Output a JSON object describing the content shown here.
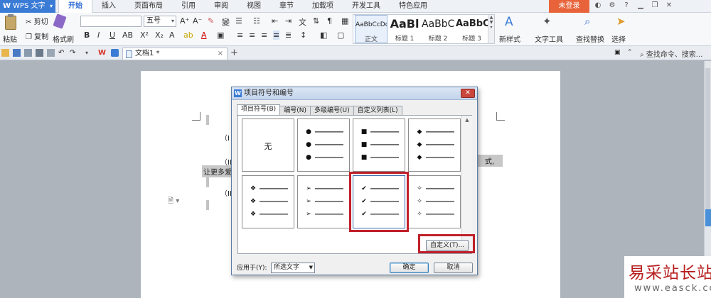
{
  "app": {
    "logo": "W",
    "name": "WPS 文字",
    "menu_arrow": "▾"
  },
  "menu_tabs": [
    "开始",
    "插入",
    "页面布局",
    "引用",
    "审阅",
    "视图",
    "章节",
    "加载项",
    "开发工具",
    "特色应用"
  ],
  "login_label": "未登录",
  "ribbon": {
    "paste": "粘贴",
    "cut": "剪切",
    "copy": "复制",
    "format_painter": "格式刷",
    "font_name": "",
    "font_size": "五号",
    "styles": [
      {
        "preview": "AaBbCcDd",
        "caption": "正文"
      },
      {
        "preview": "AaBl",
        "caption": "标题 1"
      },
      {
        "preview": "AaBbC",
        "caption": "标题 2"
      },
      {
        "preview": "AaBbC",
        "caption": "标题 3"
      }
    ],
    "new_style": "新样式",
    "text_tools": "文字工具",
    "find_replace": "查找替换",
    "select": "选择"
  },
  "quick_bar": {
    "doc_tab": "文档1 *",
    "close": "×",
    "add_tab": "+",
    "search_cmd": "查找命令、搜索..."
  },
  "document": {
    "line1": "（I",
    "line2": "（II",
    "line2_tail": "式,",
    "line3": "让更多爱",
    "line4": "（III"
  },
  "dialog": {
    "title": "项目符号和编号",
    "close": "✕",
    "tabs": [
      "项目符号(B)",
      "编号(N)",
      "多级编号(U)",
      "自定义列表(L)"
    ],
    "none_label": "无",
    "bullets": [
      "●",
      "■",
      "◆",
      "❖",
      "➢",
      "✔",
      "✧"
    ],
    "customize": "自定义(T)...",
    "apply_label": "应用于(Y):",
    "apply_value": "所选文字",
    "ok": "确定",
    "cancel": "取消"
  },
  "watermark": {
    "main": "易采站长站",
    "sub": "www.easck.com"
  },
  "colors": {
    "accent": "#3a7bd5",
    "login": "#e8633a",
    "highlight": "#c0202a"
  }
}
